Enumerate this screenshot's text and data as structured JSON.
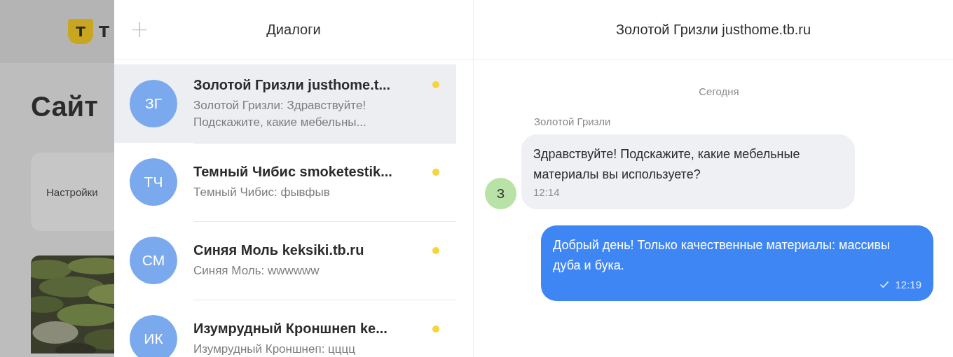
{
  "background_page": {
    "logo_mark": "Т",
    "logo_text": "Т",
    "heading": "Сайт",
    "card_label": "Настройки"
  },
  "dialogs": {
    "title": "Диалоги",
    "add_button": "+",
    "items": [
      {
        "initials": "ЗГ",
        "title": "Золотой Гризли justhome.t...",
        "preview": "Золотой Гризли: Здравствуйте! Подскажите, какие мебельны...",
        "unread": true,
        "selected": true
      },
      {
        "initials": "ТЧ",
        "title": "Темный Чибис smoketestik...",
        "preview": "Темный Чибис: фывфыв",
        "unread": true,
        "selected": false
      },
      {
        "initials": "СМ",
        "title": "Синяя Моль keksiki.tb.ru",
        "preview": "Синяя Моль: wwwwww",
        "unread": true,
        "selected": false
      },
      {
        "initials": "ИК",
        "title": "Изумрудный Кроншнеп ke...",
        "preview": "Изумрудный Кроншнеп: цццц",
        "unread": true,
        "selected": false
      }
    ]
  },
  "chat": {
    "title": "Золотой Гризли justhome.tb.ru",
    "date": "Сегодня",
    "messages": [
      {
        "kind": "incoming",
        "sender": "Золотой Гризли",
        "avatar": "З",
        "text": "Здравствуйте! Подскажите, какие мебельные материалы вы используете?",
        "time": "12:14"
      },
      {
        "kind": "outgoing",
        "text": "Добрый день! Только качественные материалы: массивы дуба и бука.",
        "time": "12:19",
        "read": true
      }
    ]
  }
}
